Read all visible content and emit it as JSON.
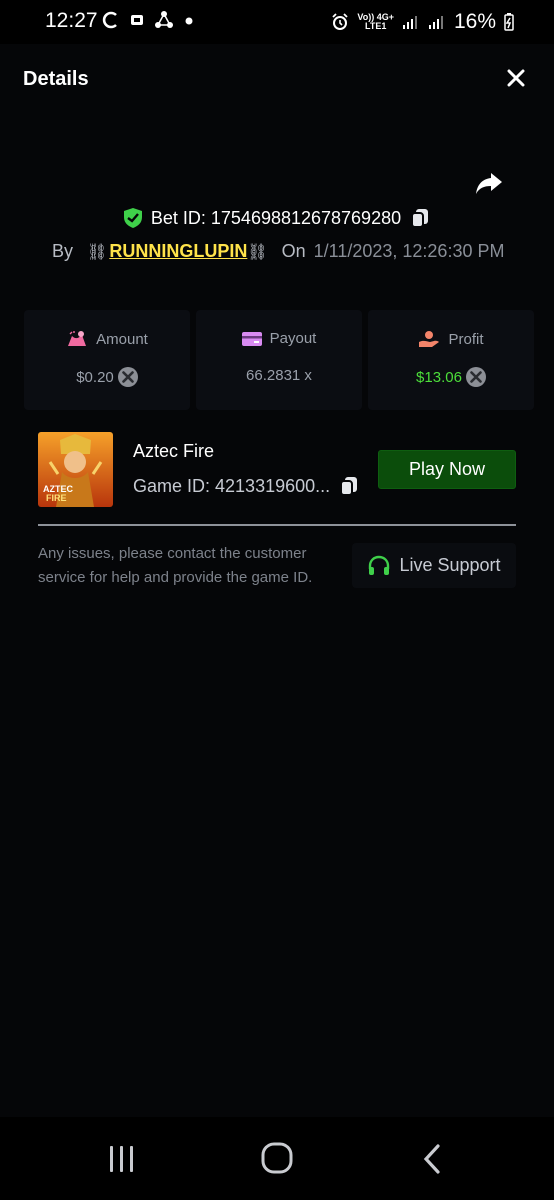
{
  "status_bar": {
    "time": "12:27",
    "network_top": "Vo)) 4G+",
    "network_bottom": "LTE1",
    "battery": "16%"
  },
  "header": {
    "title": "Details"
  },
  "bet": {
    "label": "Bet ID: 1754698812678769280",
    "by_label": "By",
    "username": "RUNNINGLUPIN",
    "chain_symbol": "⛓",
    "on_label": "On",
    "datetime": "1/11/2023, 12:26:30 PM"
  },
  "stats": {
    "amount": {
      "label": "Amount",
      "value": "$0.20"
    },
    "payout": {
      "label": "Payout",
      "value": "66.2831 x"
    },
    "profit": {
      "label": "Profit",
      "value": "$13.06"
    }
  },
  "game": {
    "name": "Aztec Fire",
    "id_label": "Game ID: 4213319600...",
    "thumb_text_1": "AZTEC",
    "thumb_text_2": "FIRE",
    "play_label": "Play Now"
  },
  "support": {
    "text": "Any issues, please contact the customer service for help and provide the game ID.",
    "button_label": "Live Support"
  },
  "colors": {
    "accent_green": "#4cde3a",
    "play_button": "#0b4d0b",
    "username": "#ffe34a"
  }
}
